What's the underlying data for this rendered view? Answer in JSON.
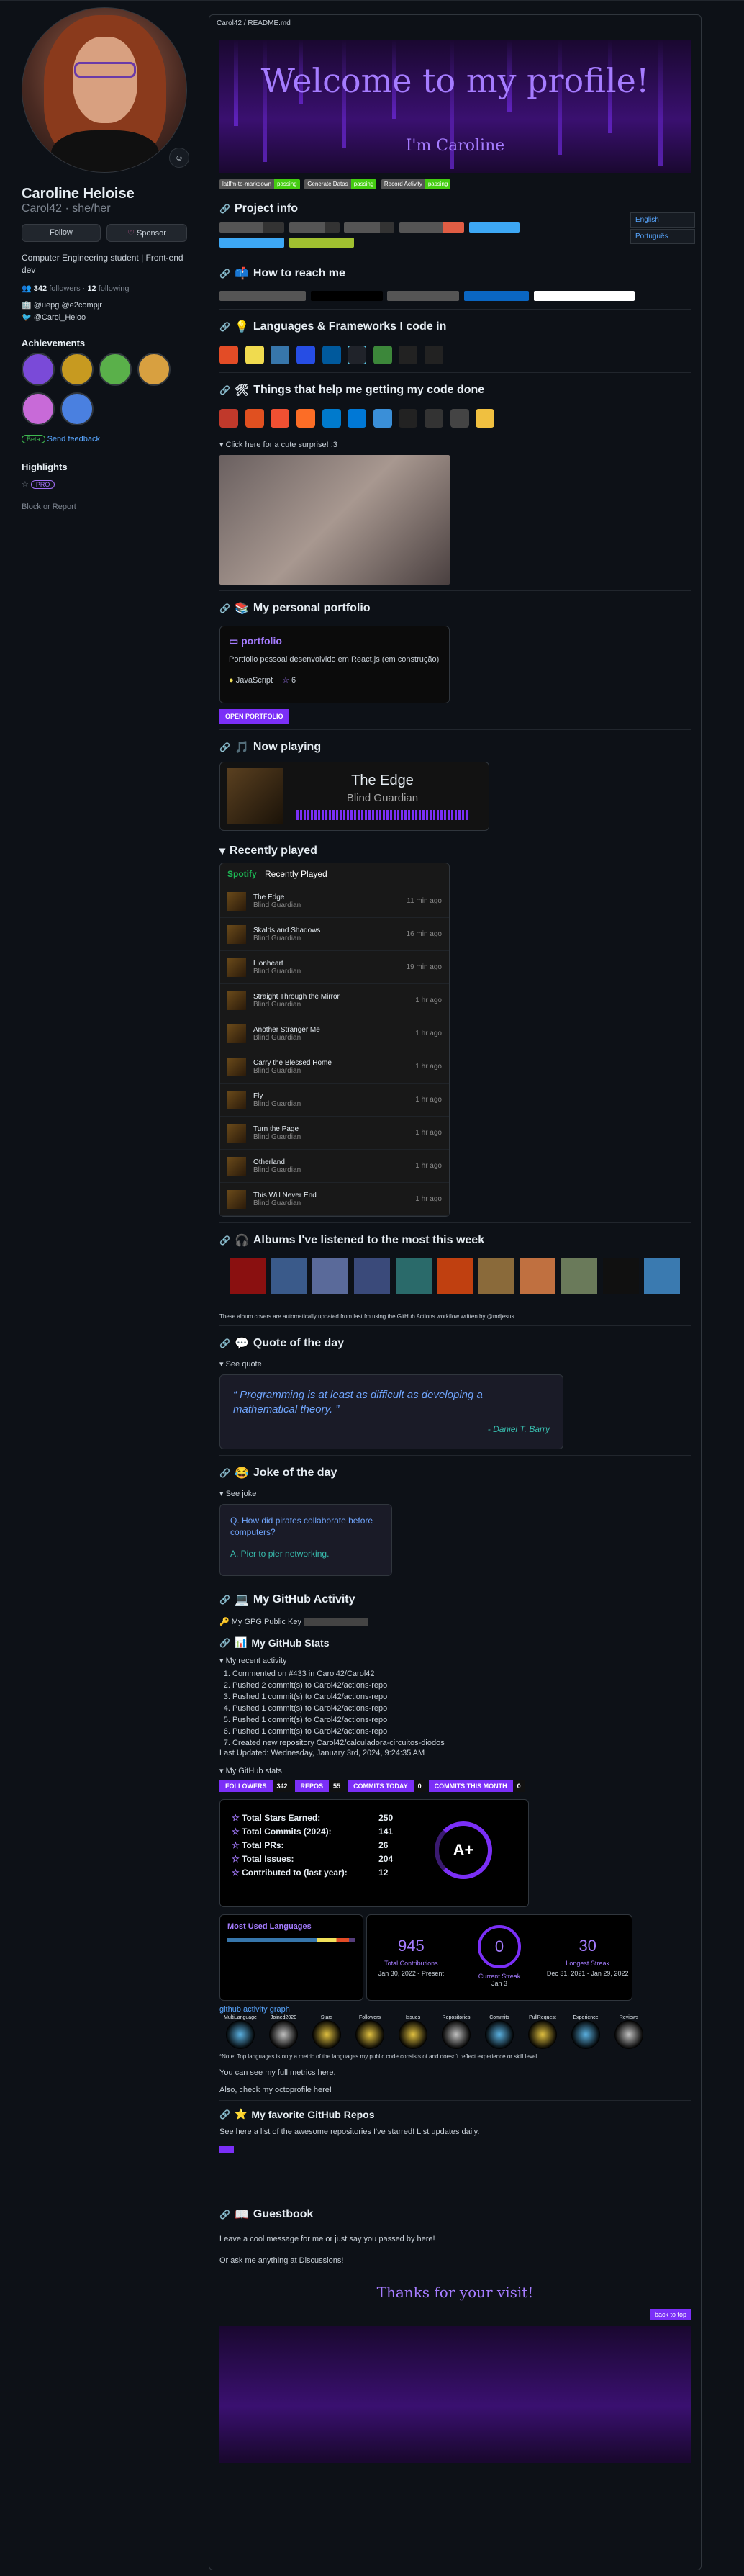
{
  "profile": {
    "name": "Caroline Heloise",
    "username": "Carol42 · she/her",
    "follow_label": "Follow",
    "sponsor_label": "Sponsor",
    "bio": "Computer Engineering student | Front-end dev",
    "followers_count": "342",
    "followers_label": "followers",
    "following_count": "12",
    "following_label": "following",
    "org": "@uepg @e2compjr",
    "twitter": "@Carol_Heloo",
    "achievements_title": "Achievements",
    "beta_label": "Beta",
    "feedback_label": "Send feedback",
    "highlights_title": "Highlights",
    "pro_label": "PRO",
    "block_label": "Block or Report"
  },
  "readme": {
    "path": "Carol42 / README.md",
    "banner_title": "Welcome to my profile!",
    "banner_sub": "I'm Caroline",
    "action_badges": [
      "latlfm-to-markdown",
      "Generate Datas",
      "Record Activity"
    ],
    "passing": "passing",
    "lang_en": "English",
    "lang_pt": "Português",
    "project_info_title": "Project info",
    "reach_title": "How to reach me",
    "langs_title": "Languages & Frameworks I code in",
    "tools_title": "Things that help me getting my code done",
    "surprise_label": "Click here for a cute surprise! :3",
    "portfolio_title": "My personal portfolio",
    "portfolio_name": "portfolio",
    "portfolio_desc": "Portfolio pessoal desenvolvido em React.js (em construção)",
    "portfolio_lang": "JavaScript",
    "portfolio_stars": "6",
    "open_portfolio": "OPEN PORTFOLIO",
    "now_playing_title": "Now playing",
    "np_song": "The Edge",
    "np_artist": "Blind Guardian",
    "recently_played_title": "Recently played",
    "spotify_label": "Spotify",
    "recently_played_label": "Recently Played",
    "recent": [
      {
        "t": "The Edge",
        "a": "Blind Guardian",
        "time": "11 min ago"
      },
      {
        "t": "Skalds and Shadows",
        "a": "Blind Guardian",
        "time": "16 min ago"
      },
      {
        "t": "Lionheart",
        "a": "Blind Guardian",
        "time": "19 min ago"
      },
      {
        "t": "Straight Through the Mirror",
        "a": "Blind Guardian",
        "time": "1 hr ago"
      },
      {
        "t": "Another Stranger Me",
        "a": "Blind Guardian",
        "time": "1 hr ago"
      },
      {
        "t": "Carry the Blessed Home",
        "a": "Blind Guardian",
        "time": "1 hr ago"
      },
      {
        "t": "Fly",
        "a": "Blind Guardian",
        "time": "1 hr ago"
      },
      {
        "t": "Turn the Page",
        "a": "Blind Guardian",
        "time": "1 hr ago"
      },
      {
        "t": "Otherland",
        "a": "Blind Guardian",
        "time": "1 hr ago"
      },
      {
        "t": "This Will Never End",
        "a": "Blind Guardian",
        "time": "1 hr ago"
      }
    ],
    "albums_title": "Albums I've listened to the most this week",
    "albums_note": "These album covers are automatically updated from last.fm using the GitHub Actions workflow written by @mdjesus",
    "quote_title": "Quote of the day",
    "see_quote": "See quote",
    "quote_text": "Programming is at least as difficult as developing a mathematical theory.",
    "quote_author": "- Daniel T. Barry",
    "joke_title": "Joke of the day",
    "see_joke": "See joke",
    "joke_q": "Q. How did pirates collaborate before computers?",
    "joke_a": "A. Pier to pier networking.",
    "activity_title": "My GitHub Activity",
    "gpg_label": "My GPG Public Key",
    "stats_title": "My GitHub Stats",
    "recent_activity_label": "My recent activity",
    "activity_items": [
      "Commented on #433 in Carol42/Carol42",
      "Pushed 2 commit(s) to Carol42/actions-repo",
      "Pushed 1 commit(s) to Carol42/actions-repo",
      "Pushed 1 commit(s) to Carol42/actions-repo",
      "Pushed 1 commit(s) to Carol42/actions-repo",
      "Pushed 1 commit(s) to Carol42/actions-repo",
      "Created new repository Carol42/calculadora-circuitos-diodos"
    ],
    "last_updated": "Last Updated: Wednesday, January 3rd, 2024, 9:24:35 AM",
    "github_stats_label": "My GitHub stats",
    "stats_badges": [
      {
        "l": "FOLLOWERS",
        "r": "342"
      },
      {
        "l": "REPOS",
        "r": "55"
      },
      {
        "l": "COMMITS TODAY",
        "r": "0"
      },
      {
        "l": "COMMITS THIS MONTH",
        "r": "0"
      }
    ],
    "stats_rows": [
      {
        "k": "Total Stars Earned:",
        "v": "250"
      },
      {
        "k": "Total Commits (2024):",
        "v": "141"
      },
      {
        "k": "Total PRs:",
        "v": "26"
      },
      {
        "k": "Total Issues:",
        "v": "204"
      },
      {
        "k": "Contributed to (last year):",
        "v": "12"
      }
    ],
    "grade": "A+",
    "mul_title": "Most Used Languages",
    "total_contrib": "945",
    "total_contrib_label": "Total Contributions",
    "total_contrib_range": "Jan 30, 2022 - Present",
    "cur_streak": "0",
    "cur_streak_label": "Current Streak",
    "cur_streak_date": "Jan 3",
    "long_streak": "30",
    "long_streak_label": "Longest Streak",
    "long_streak_range": "Dec 31, 2021 - Jan 29, 2022",
    "graph_alt": "github activity graph",
    "trophies": [
      "MultiLanguage",
      "Joined2020",
      "Stars",
      "Followers",
      "Issues",
      "Repositories",
      "Commits",
      "PullRequest",
      "Experience",
      "Reviews"
    ],
    "trophy_note": "*Note: Top languages is only a metric of the languages my public code consists of and doesn't reflect experience or skill level.",
    "full_metrics": "You can see my full metrics here.",
    "octoprofile": "Also, check my octoprofile here!",
    "fav_repos_title": "My favorite GitHub Repos",
    "fav_repos_text": "See here a list of the awesome repositories I've starred! List updates daily.",
    "guestbook_title": "Guestbook",
    "guestbook_text": "Leave a cool message for me or just say you passed by here!",
    "discussions_text": "Or ask me anything at Discussions!",
    "thanks": "Thanks for your visit!",
    "back_to_top": "back to top"
  }
}
